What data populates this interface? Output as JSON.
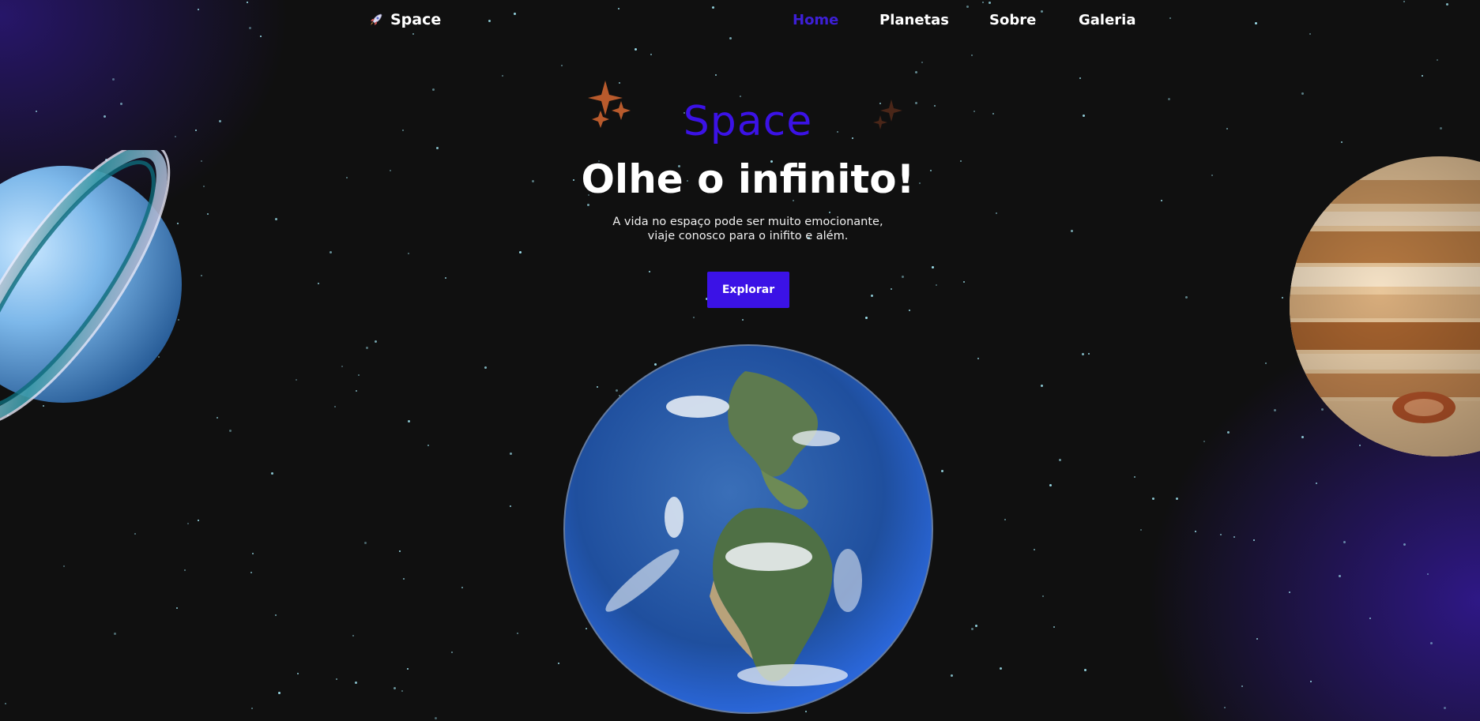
{
  "header": {
    "logo_text": "Space",
    "logo_icon": "rocket-icon",
    "nav": [
      {
        "label": "Home",
        "active": true
      },
      {
        "label": "Planetas",
        "active": false
      },
      {
        "label": "Sobre",
        "active": false
      },
      {
        "label": "Galeria",
        "active": false
      }
    ]
  },
  "hero": {
    "kicker": "Space",
    "headline": "Olhe o infinito!",
    "subtitle_line1": "A vida no espaço pode ser muito emocionante,",
    "subtitle_line2": "viaje conosco para o inifito e além.",
    "cta_label": "Explorar"
  },
  "images": {
    "left_planet": "uranus-planet",
    "right_planet": "jupiter-planet",
    "center_planet": "earth-globe",
    "sparkles": "sparkle-icon"
  },
  "colors": {
    "accent": "#3b12e6",
    "background": "#101010",
    "text": "#ffffff",
    "star": "#9fe3f0"
  }
}
